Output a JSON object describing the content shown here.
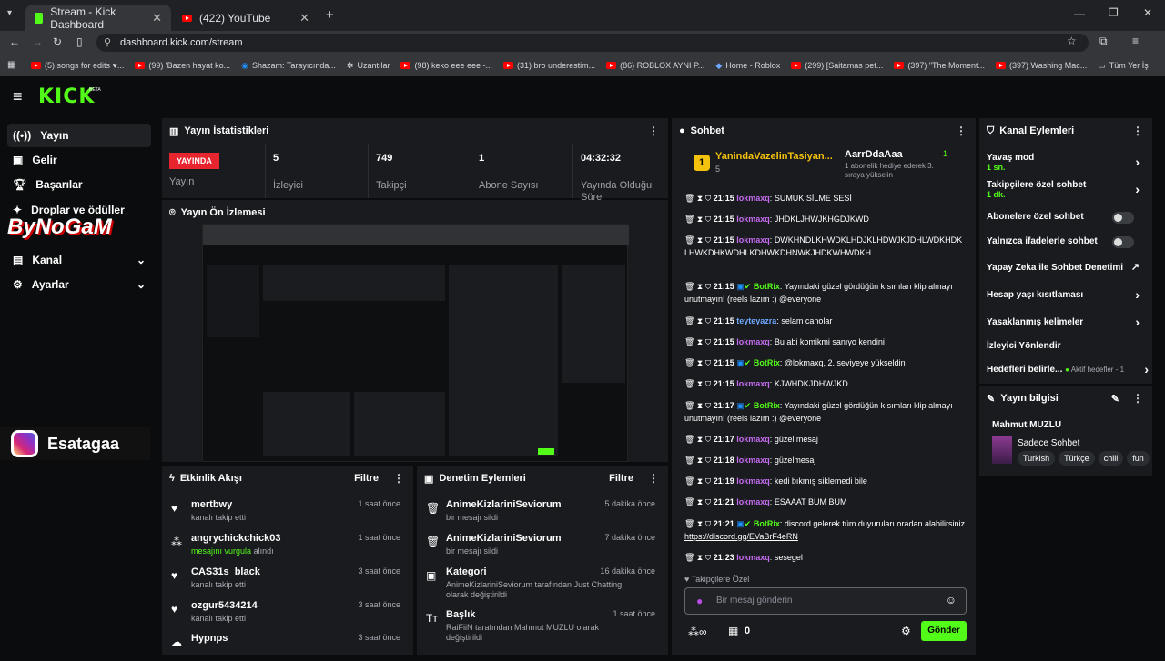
{
  "browser": {
    "tabs": [
      {
        "label": "Stream - Kick Dashboard"
      },
      {
        "label": "(422) YouTube"
      }
    ],
    "url": "dashboard.kick.com/stream",
    "bookmarks": [
      "(5) songs for edits ♥...",
      "(99) 'Bazen hayat ko...",
      "Shazam: Tarayıcında...",
      "Uzantılar",
      "(98) keko eee eee -...",
      "(31) bro underestim...",
      "(86) ROBLOX AYNI P...",
      "Home - Roblox",
      "(299) [Saitamas pet...",
      "(397) \"The Moment...",
      "(397) Washing Mac...",
      "Tüm Yer İş"
    ]
  },
  "app": {
    "logo": "KICK",
    "beta": "BETA"
  },
  "sidebar": {
    "items": [
      {
        "label": "Yayın",
        "icon": "broadcast-icon"
      },
      {
        "label": "Gelir",
        "icon": "wallet-icon"
      },
      {
        "label": "Başarılar",
        "icon": "trophy-icon"
      },
      {
        "label": "Droplar ve ödüller",
        "icon": "gift-icon"
      },
      {
        "label": "Kanal",
        "icon": "screen-icon"
      },
      {
        "label": "Ayarlar",
        "icon": "gear-icon"
      }
    ],
    "overlay_text": "ByNoGaM",
    "instagram": "Esatagaa"
  },
  "stats": {
    "title": "Yayın İstatistikleri",
    "live_badge": "YAYINDA",
    "live_label": "Yayın",
    "viewers": "5",
    "viewers_label": "İzleyici",
    "followers": "749",
    "followers_label": "Takipçi",
    "subs": "1",
    "subs_label": "Abone Sayısı",
    "uptime": "04:32:32",
    "uptime_label": "Yayında Olduğu Süre"
  },
  "preview": {
    "title": "Yayın Ön İzlemesi"
  },
  "activity": {
    "title": "Etkinlik Akışı",
    "filter": "Filtre",
    "items": [
      {
        "name": "mertbwy",
        "sub": "kanalı takip etti",
        "time": "1 saat önce"
      },
      {
        "name": "angrychickchick03",
        "sub": "mesajını vurgula",
        "sub2": "alındı",
        "time": "1 saat önce"
      },
      {
        "name": "CAS31s_black",
        "sub": "kanalı takip etti",
        "time": "3 saat önce"
      },
      {
        "name": "ozgur5434214",
        "sub": "kanalı takip etti",
        "time": "3 saat önce"
      },
      {
        "name": "Hypnps",
        "sub": "",
        "time": "3 saat önce"
      }
    ]
  },
  "moderation": {
    "title": "Denetim Eylemleri",
    "filter": "Filtre",
    "items": [
      {
        "name": "AnimeKizlariniSeviorum",
        "sub": "bir mesajı sildi",
        "time": "5 dakika önce"
      },
      {
        "name": "AnimeKizlariniSeviorum",
        "sub": "bir mesajı sildi",
        "time": "7 dakika önce"
      },
      {
        "name": "Kategori",
        "sub": "AnimeKizlariniSeviorum tarafından Just Chatting olarak değiştirildi",
        "time": "16 dakika önce"
      },
      {
        "name": "Başlık",
        "sub": "RaiFiiN tarafından Mahmut MUZLU olarak değiştirildi",
        "time": "1 saat önce"
      }
    ]
  },
  "chat": {
    "title": "Sohbet",
    "pinned_user": "YanindaVazelinTasiyan...",
    "pinned_count": "5",
    "gift_user": "AarrDdaAaa",
    "gift_count": "1",
    "gift_text": "1 abonelik hediye ederek 3. sıraya yükselin",
    "messages": [
      {
        "time": "21:15",
        "user": "lokmaxq",
        "text": "SUMUK SİLME SESİ"
      },
      {
        "time": "21:15",
        "user": "lokmaxq",
        "text": "JHDKLJHWJKHGDJKWD"
      },
      {
        "time": "21:15",
        "user": "lokmaxq",
        "text": "DWKHNDLKHWDKLHDJKLHDWJKJDHLWDKHDKLHWKDHKWDHLKDHWKDHNWKJHDKWHWDKH"
      },
      {
        "time": "21:15",
        "user": "BotRix",
        "text": "Yayındaki güzel gördüğün kısımları klip almayı unutmayın! (reels lazım :) @everyone"
      },
      {
        "time": "21:15",
        "user": "teyteyazra",
        "text": "selam canolar"
      },
      {
        "time": "21:15",
        "user": "lokmaxq",
        "text": "Bu abi komikmi sanıyo kendini"
      },
      {
        "time": "21:15",
        "user": "BotRix",
        "text": "@lokmaxq, 2. seviyeye yükseldin"
      },
      {
        "time": "21:15",
        "user": "lokmaxq",
        "text": "KJWHDKJDHWJKD"
      },
      {
        "time": "21:17",
        "user": "BotRix",
        "text": "Yayındaki güzel gördüğün kısımları klip almayı unutmayın! (reels lazım :) @everyone"
      },
      {
        "time": "21:17",
        "user": "lokmaxq",
        "text": "güzel mesaj"
      },
      {
        "time": "21:18",
        "user": "lokmaxq",
        "text": "güzelmesaj"
      },
      {
        "time": "21:19",
        "user": "lokmaxq",
        "text": "kedi bıkmış siklemedi bile"
      },
      {
        "time": "21:21",
        "user": "lokmaxq",
        "text": "ESAAAT BUM BUM"
      },
      {
        "time": "21:21",
        "user": "BotRix",
        "text": "discord gelerek tüm duyuruları oradan alabilirsiniz",
        "link": "https://discord.gg/EVaBrF4eRN"
      },
      {
        "time": "21:23",
        "user": "lokmaxq",
        "text": "sesegel"
      }
    ],
    "followers_only": "Takipçilere Özel",
    "input_placeholder": "Bir mesaj gönderin",
    "count": "0",
    "send": "Gönder"
  },
  "channel_actions": {
    "title": "Kanal Eylemleri",
    "items": [
      {
        "label": "Yavaş mod",
        "sub": "1 sn.",
        "type": "chevron"
      },
      {
        "label": "Takipçilere özel sohbet",
        "sub": "1 dk.",
        "type": "chevron"
      },
      {
        "label": "Abonelere özel sohbet",
        "type": "toggle"
      },
      {
        "label": "Yalnızca ifadelerle sohbet",
        "type": "toggle"
      },
      {
        "label": "Yapay Zeka ile Sohbet Denetimi",
        "type": "external"
      },
      {
        "label": "Hesap yaşı kısıtlaması",
        "type": "chevron"
      },
      {
        "label": "Yasaklanmış kelimeler",
        "type": "chevron"
      },
      {
        "label": "İzleyici Yönlendir",
        "type": "none"
      },
      {
        "label": "Hedefleri belirle...",
        "sub": "Aktif hedefler - 1",
        "type": "chevron"
      }
    ]
  },
  "stream_info": {
    "title": "Yayın bilgisi",
    "stream_title": "Mahmut MUZLU",
    "category": "Sadece Sohbet",
    "tags": [
      "Turkish",
      "Türkçe",
      "chill",
      "fun"
    ]
  }
}
